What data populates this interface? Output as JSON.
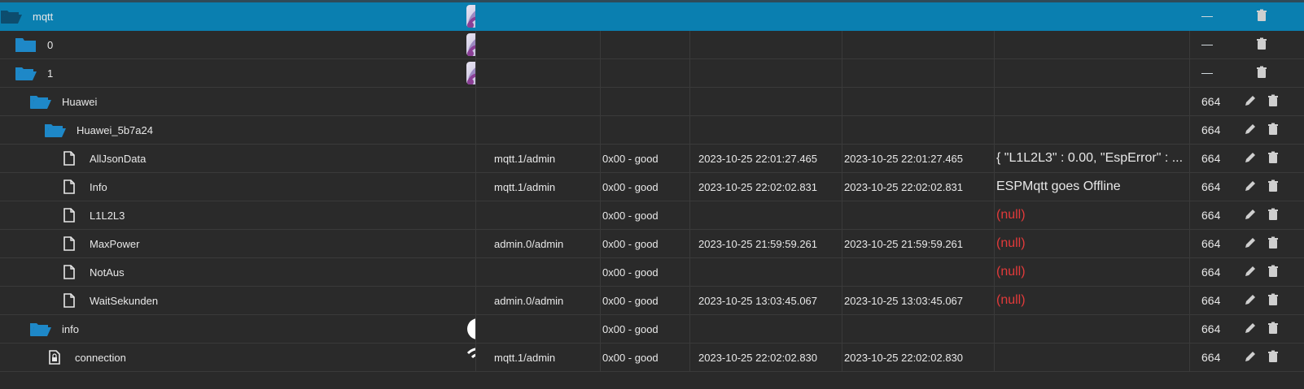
{
  "rows": [
    {
      "name": "mqtt",
      "user": "",
      "ack": "",
      "ts": "",
      "lc": "",
      "value": "",
      "perm": "",
      "selected": true,
      "type": "folder-open-dark",
      "role": "state-icon"
    },
    {
      "name": "0",
      "user": "",
      "ack": "",
      "ts": "",
      "lc": "",
      "value": "",
      "perm": "",
      "type": "folder-closed",
      "role": "state-icon"
    },
    {
      "name": "1",
      "user": "",
      "ack": "",
      "ts": "",
      "lc": "",
      "value": "",
      "perm": "",
      "type": "folder-open",
      "role": "state-icon"
    },
    {
      "name": "Huawei",
      "user": "",
      "ack": "",
      "ts": "",
      "lc": "",
      "value": "",
      "perm": "664",
      "type": "folder-open"
    },
    {
      "name": "Huawei_5b7a24",
      "user": "",
      "ack": "",
      "ts": "",
      "lc": "",
      "value": "",
      "perm": "664",
      "type": "folder-open"
    },
    {
      "name": "AllJsonData",
      "user": "mqtt.1/admin",
      "ack": "0x00 - good",
      "ts": "2023-10-25 22:01:27.465",
      "lc": "2023-10-25 22:01:27.465",
      "value": "{ \"L1L2L3\" : 0.00, \"EspError\" : ...",
      "perm": "664",
      "type": "file"
    },
    {
      "name": "Info",
      "user": "mqtt.1/admin",
      "ack": "0x00 - good",
      "ts": "2023-10-25 22:02:02.831",
      "lc": "2023-10-25 22:02:02.831",
      "value": "ESPMqtt goes Offline",
      "perm": "664",
      "type": "file"
    },
    {
      "name": "L1L2L3",
      "user": "",
      "ack": "0x00 - good",
      "ts": "",
      "lc": "",
      "value": "(null)",
      "perm": "664",
      "type": "file",
      "null": true
    },
    {
      "name": "MaxPower",
      "user": "admin.0/admin",
      "ack": "0x00 - good",
      "ts": "2023-10-25 21:59:59.261",
      "lc": "2023-10-25 21:59:59.261",
      "value": "(null)",
      "perm": "664",
      "type": "file",
      "null": true
    },
    {
      "name": "NotAus",
      "user": "",
      "ack": "0x00 - good",
      "ts": "",
      "lc": "",
      "value": "(null)",
      "perm": "664",
      "type": "file",
      "null": true
    },
    {
      "name": "WaitSekunden",
      "user": "admin.0/admin",
      "ack": "0x00 - good",
      "ts": "2023-10-25 13:03:45.067",
      "lc": "2023-10-25 13:03:45.067",
      "value": "(null)",
      "perm": "664",
      "type": "file",
      "null": true
    },
    {
      "name": "info",
      "user": "",
      "ack": "0x00 - good",
      "ts": "",
      "lc": "",
      "value": "",
      "perm": "664",
      "type": "folder-open",
      "role": "info-icon"
    },
    {
      "name": "connection",
      "user": "mqtt.1/admin",
      "ack": "0x00 - good",
      "ts": "2023-10-25 22:02:02.830",
      "lc": "2023-10-25 22:02:02.830",
      "value": "",
      "perm": "664",
      "type": "lock-file",
      "role": "wifi-icon"
    }
  ],
  "colors": {
    "selected": "#0a7fb0",
    "folder": "#1e88c8",
    "null": "#e23a3a"
  }
}
